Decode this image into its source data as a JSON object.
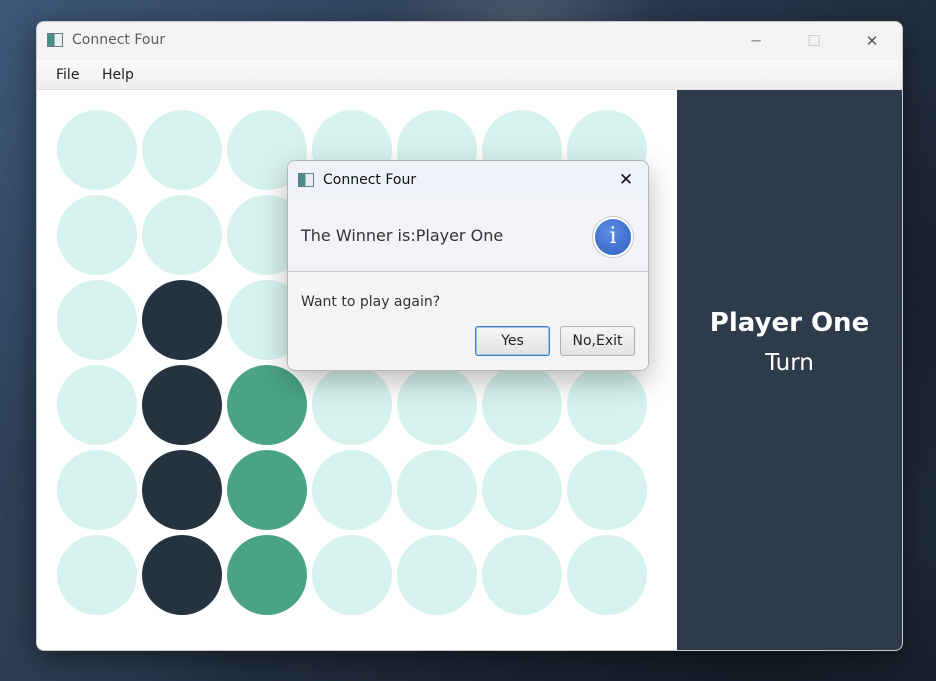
{
  "window": {
    "title": "Connect Four",
    "icon": "app-window-icon",
    "controls": {
      "minimize": "─",
      "maximize": "☐",
      "close": "✕"
    }
  },
  "menu": {
    "items": [
      {
        "label": "File"
      },
      {
        "label": "Help"
      }
    ]
  },
  "colors": {
    "empty": "#d7f3ee",
    "player_one": "#253240",
    "player_two": "#4aa484",
    "side_panel": "#2e3b4a"
  },
  "board": {
    "columns": 7,
    "rows": 6,
    "cells": [
      [
        "empty",
        "empty",
        "empty",
        "empty",
        "empty",
        "empty",
        "empty"
      ],
      [
        "empty",
        "empty",
        "empty",
        "empty",
        "empty",
        "empty",
        "empty"
      ],
      [
        "empty",
        "player_one",
        "empty",
        "empty",
        "empty",
        "empty",
        "empty"
      ],
      [
        "empty",
        "player_one",
        "player_two",
        "empty",
        "empty",
        "empty",
        "empty"
      ],
      [
        "empty",
        "player_one",
        "player_two",
        "empty",
        "empty",
        "empty",
        "empty"
      ],
      [
        "empty",
        "player_one",
        "player_two",
        "empty",
        "empty",
        "empty",
        "empty"
      ]
    ]
  },
  "side_panel": {
    "player_name": "Player One",
    "turn_label": "Turn"
  },
  "dialog": {
    "title": "Connect Four",
    "close": "✕",
    "header_text": "The Winner is:Player One",
    "icon": "info-icon",
    "icon_glyph": "i",
    "content_text": "Want to play again?",
    "buttons": [
      {
        "label": "Yes",
        "default": true
      },
      {
        "label": "No,Exit",
        "default": false
      }
    ]
  }
}
